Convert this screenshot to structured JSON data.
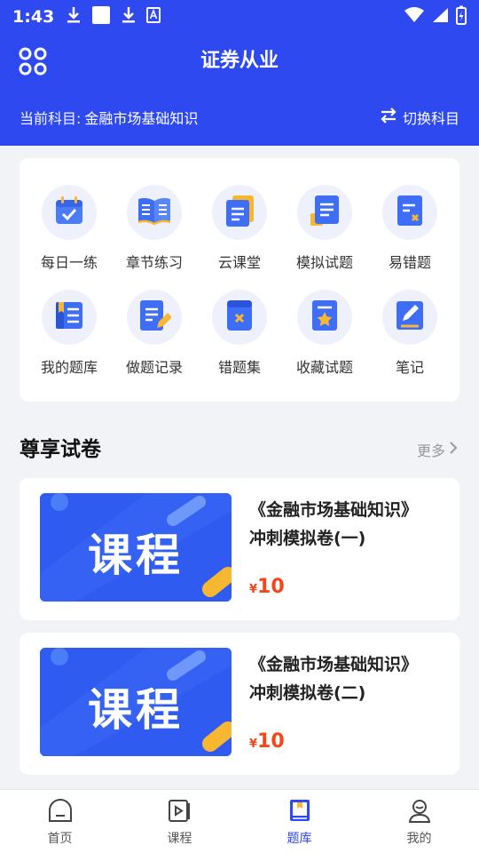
{
  "status_bar": {
    "time": "1:43",
    "left_icons": [
      "download-icon",
      "square-icon",
      "download-icon",
      "font-icon"
    ],
    "right_icons": [
      "wifi-icon",
      "signal-icon",
      "battery-charging-icon"
    ]
  },
  "header": {
    "title": "证券从业",
    "subject_label": "当前科目:",
    "subject_value": "金融市场基础知识",
    "switch_label": "切换科目",
    "bg_color": "#2e49f0"
  },
  "grid": [
    {
      "label": "每日一练",
      "icon": "calendar-check-icon"
    },
    {
      "label": "章节练习",
      "icon": "open-book-icon"
    },
    {
      "label": "云课堂",
      "icon": "cloud-class-icon"
    },
    {
      "label": "模拟试题",
      "icon": "mock-exam-icon"
    },
    {
      "label": "易错题",
      "icon": "error-prone-icon"
    },
    {
      "label": "我的题库",
      "icon": "question-bank-icon"
    },
    {
      "label": "做题记录",
      "icon": "practice-record-icon"
    },
    {
      "label": "错题集",
      "icon": "wrong-questions-icon"
    },
    {
      "label": "收藏试题",
      "icon": "favorite-questions-icon"
    },
    {
      "label": "笔记",
      "icon": "notes-icon"
    }
  ],
  "section": {
    "title": "尊享试卷",
    "more": "更多"
  },
  "exams": [
    {
      "thumb_text": "课程",
      "title_line1": "《金融市场基础知识》",
      "title_line2": "冲刺模拟卷(一)",
      "currency": "¥",
      "price": "10"
    },
    {
      "thumb_text": "课程",
      "title_line1": "《金融市场基础知识》",
      "title_line2": "冲刺模拟卷(二)",
      "currency": "¥",
      "price": "10"
    }
  ],
  "tabs": [
    {
      "label": "首页",
      "icon": "home-icon"
    },
    {
      "label": "课程",
      "icon": "course-play-icon"
    },
    {
      "label": "题库",
      "icon": "question-bank-tab-icon",
      "active": true
    },
    {
      "label": "我的",
      "icon": "profile-icon"
    }
  ],
  "colors": {
    "primary": "#2e49f0",
    "price": "#f5461a",
    "icon_bg": "#eef1fb"
  }
}
